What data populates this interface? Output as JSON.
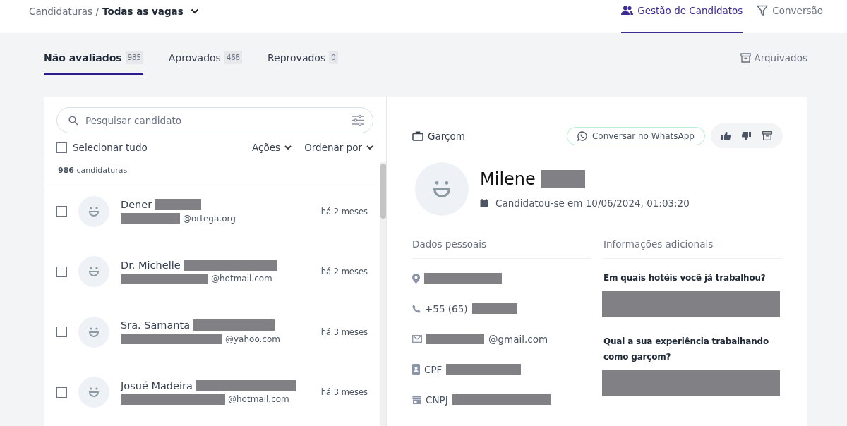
{
  "breadcrumb": {
    "parent": "Candidaturas /",
    "current": "Todas as vagas"
  },
  "top_nav": [
    {
      "label": "Gestão de Candidatos",
      "kind": "people",
      "selected": true
    },
    {
      "label": "Conversão",
      "kind": "funnel",
      "selected": false
    }
  ],
  "tabs": [
    {
      "label": "Não avaliados",
      "count": "985",
      "selected": true
    },
    {
      "label": "Aprovados",
      "count": "466",
      "selected": false
    },
    {
      "label": "Reprovados",
      "count": "0",
      "selected": false
    }
  ],
  "archived_link": "Arquivados",
  "search": {
    "placeholder": "Pesquisar candidato"
  },
  "select_all": {
    "label": "Selecionar tudo",
    "checked": false
  },
  "actions_menu": "Ações",
  "sort_menu": "Ordenar por",
  "count_bold": "986",
  "count_label": "candidaturas",
  "candidates": [
    {
      "name": "Dener",
      "email": "@ortega.org",
      "time": "há 2 meses",
      "checked": false
    },
    {
      "name": "Dr. Michelle",
      "email": "@hotmail.com",
      "time": "há 2 meses",
      "checked": false
    },
    {
      "name": "Sra. Samanta",
      "email": "@yahoo.com",
      "time": "há 3 meses",
      "checked": false
    },
    {
      "name": "Josué Madeira",
      "email": "@hotmail.com",
      "time": "há 3 meses",
      "checked": false
    }
  ],
  "detail": {
    "job": "Garçom",
    "whatsapp_button": "Conversar no WhatsApp",
    "name": "Milene",
    "applied": "Candidatou-se em 10/06/2024, 01:03:20",
    "personal_heading": "Dados pessoais",
    "extra_heading": "Informações adicionais",
    "personal": [
      {
        "kind": "location"
      },
      {
        "kind": "phone",
        "text": "+55 (65)"
      },
      {
        "kind": "email",
        "text": "@gmail.com"
      },
      {
        "kind": "id",
        "text": "CPF"
      },
      {
        "kind": "store",
        "text": "CNPJ"
      }
    ],
    "questions": [
      "Em quais hotéis você já trabalhou?",
      "Qual a sua experiência trabalhando como garçom?"
    ]
  }
}
